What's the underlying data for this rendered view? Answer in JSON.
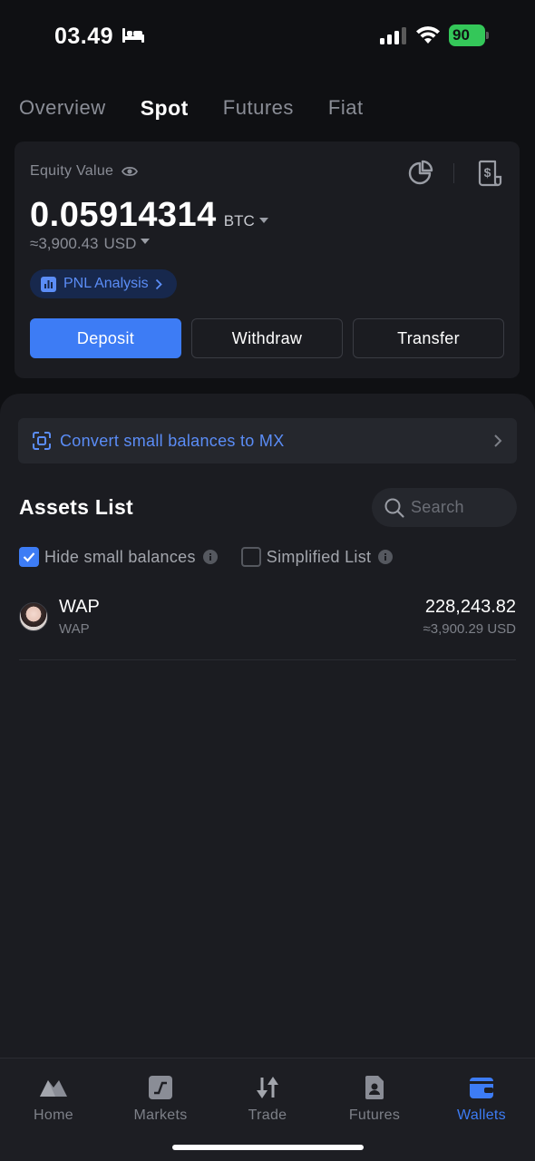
{
  "status_bar": {
    "time": "03.49",
    "battery": "90"
  },
  "top_tabs": [
    {
      "label": "Overview",
      "active": false
    },
    {
      "label": "Spot",
      "active": true
    },
    {
      "label": "Futures",
      "active": false
    },
    {
      "label": "Fiat",
      "active": false
    }
  ],
  "equity": {
    "label": "Equity Value",
    "value": "0.05914314",
    "unit": "BTC",
    "usd_value": "≈3,900.43",
    "usd_unit": "USD",
    "pnl_label": "PNL Analysis"
  },
  "actions": {
    "deposit": "Deposit",
    "withdraw": "Withdraw",
    "transfer": "Transfer"
  },
  "convert": {
    "label": "Convert small balances to MX"
  },
  "assets": {
    "title": "Assets List",
    "search_placeholder": "Search",
    "hide_small_label": "Hide small balances",
    "hide_small_checked": true,
    "simplified_label": "Simplified List",
    "simplified_checked": false,
    "items": [
      {
        "symbol": "WAP",
        "name": "WAP",
        "amount": "228,243.82",
        "usd": "≈3,900.29 USD"
      }
    ]
  },
  "bottom_nav": [
    {
      "label": "Home",
      "icon": "home-icon",
      "active": false
    },
    {
      "label": "Markets",
      "icon": "markets-icon",
      "active": false
    },
    {
      "label": "Trade",
      "icon": "trade-icon",
      "active": false
    },
    {
      "label": "Futures",
      "icon": "futures-icon",
      "active": false
    },
    {
      "label": "Wallets",
      "icon": "wallet-icon",
      "active": true
    }
  ],
  "colors": {
    "background": "#0f1013",
    "card": "#1b1c21",
    "accent": "#3d7cf5",
    "accent_text": "#5b8df7",
    "muted_text": "#8a8d96",
    "battery": "#34c759"
  }
}
